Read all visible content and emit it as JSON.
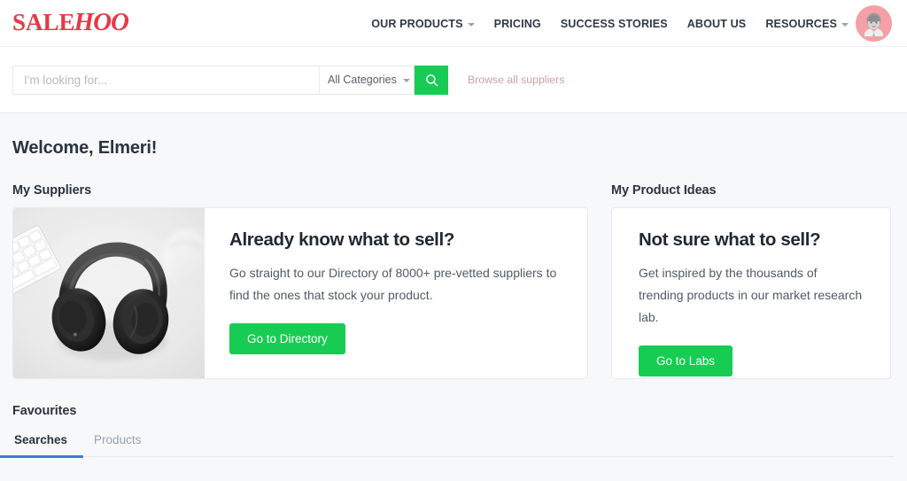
{
  "brand": {
    "logo_primary": "SALE",
    "logo_secondary": "HOO",
    "logo_color": "#e53946"
  },
  "header": {
    "nav": [
      {
        "label": "OUR PRODUCTS",
        "has_dropdown": true,
        "icon": "chevron-down-icon"
      },
      {
        "label": "PRICING",
        "has_dropdown": false,
        "icon": ""
      },
      {
        "label": "SUCCESS STORIES",
        "has_dropdown": false,
        "icon": ""
      },
      {
        "label": "ABOUT US",
        "has_dropdown": false,
        "icon": ""
      },
      {
        "label": "RESOURCES",
        "has_dropdown": true,
        "icon": "chevron-down-icon"
      }
    ],
    "avatar_icon": "user-avatar-icon",
    "avatar_bg": "#f4a0a6"
  },
  "search": {
    "placeholder": "I'm looking for...",
    "value": "",
    "category_selected": "All Categories",
    "category_caret_icon": "chevron-down-icon",
    "submit_icon": "search-icon",
    "submit_color": "#17cc52",
    "browse_link": "Browse all suppliers",
    "browse_link_color": "#c9a0a0"
  },
  "main": {
    "welcome": "Welcome, Elmeri!",
    "suppliers": {
      "section_label": "My Suppliers",
      "photo_alt": "black-headphones-on-desk-photo",
      "title": "Already know what to sell?",
      "text": "Go straight to our Directory of 8000+ pre-vetted suppliers to find the ones that stock your product.",
      "button_label": "Go to Directory"
    },
    "product_ideas": {
      "section_label": "My Product Ideas",
      "title": "Not sure what to sell?",
      "text": "Get inspired by the thousands of trending products in our market research lab.",
      "button_label": "Go to Labs"
    },
    "favourites": {
      "title": "Favourites",
      "tabs": [
        {
          "label": "Searches",
          "active": true
        },
        {
          "label": "Products",
          "active": false
        }
      ],
      "active_tab_color": "#3b7dd8"
    }
  },
  "theme": {
    "page_bg": "#f7f8fa",
    "card_bg": "#ffffff",
    "card_border": "#e6e9ed",
    "accent_green": "#17cc52",
    "text_dark": "#2b3441"
  }
}
